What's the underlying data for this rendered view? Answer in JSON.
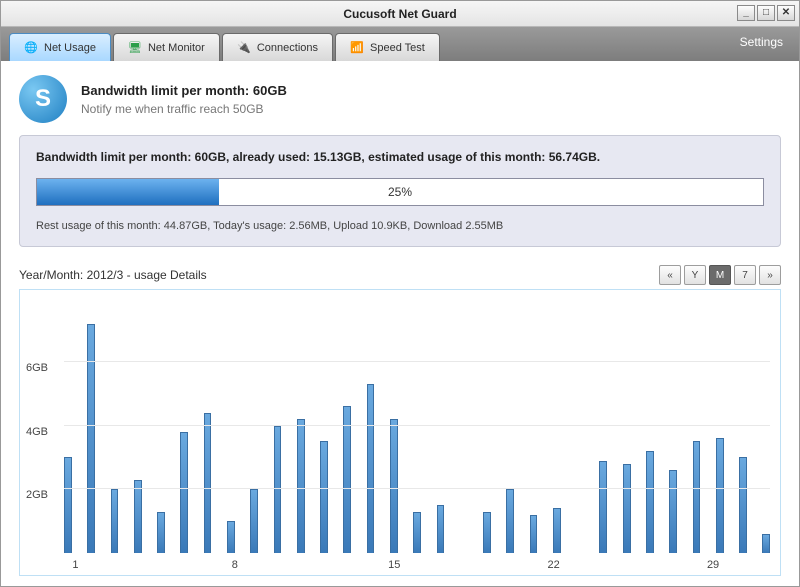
{
  "window": {
    "title": "Cucusoft Net Guard",
    "min": "_",
    "restore": "□",
    "close": "✕"
  },
  "tabs": [
    {
      "label": "Net Usage",
      "icon": "globe",
      "active": true
    },
    {
      "label": "Net Monitor",
      "icon": "monitor",
      "active": false
    },
    {
      "label": "Connections",
      "icon": "plug",
      "active": false
    },
    {
      "label": "Speed Test",
      "icon": "gauge",
      "active": false
    }
  ],
  "settings_label": "Settings",
  "header": {
    "logo_letter": "S",
    "line1": "Bandwidth limit per month: 60GB",
    "line2": "Notify me when traffic reach 50GB"
  },
  "panel": {
    "summary": "Bandwidth limit per month: 60GB, already used: 15.13GB, estimated usage of this month: 56.74GB.",
    "progress_pct": 25,
    "progress_label": "25%",
    "footer": "Rest usage of this month: 44.87GB,    Today's usage: 2.56MB, Upload 10.9KB, Download 2.55MB"
  },
  "details": {
    "label": "Year/Month: 2012/3 - usage Details",
    "range_buttons": [
      "«",
      "Y",
      "M",
      "7",
      "»"
    ],
    "active_range_index": 2
  },
  "chart_data": {
    "type": "bar",
    "title": "",
    "xlabel": "",
    "ylabel": "",
    "ylim": [
      0,
      8
    ],
    "y_ticks": [
      2,
      4,
      6
    ],
    "y_tick_labels": [
      "2GB",
      "4GB",
      "6GB"
    ],
    "x_ticks": [
      1,
      8,
      15,
      22,
      29
    ],
    "x_tick_labels": [
      "1",
      "8",
      "15",
      "22",
      "29"
    ],
    "categories": [
      1,
      2,
      3,
      4,
      5,
      6,
      7,
      8,
      9,
      10,
      11,
      12,
      13,
      14,
      15,
      16,
      17,
      18,
      19,
      20,
      21,
      22,
      23,
      24,
      25,
      26,
      27,
      28,
      29,
      30,
      31
    ],
    "values": [
      3.0,
      7.2,
      2.0,
      2.3,
      1.3,
      3.8,
      4.4,
      1.0,
      2.0,
      4.0,
      4.2,
      3.5,
      4.6,
      5.3,
      4.2,
      1.3,
      1.5,
      0.0,
      1.3,
      2.0,
      1.2,
      1.4,
      0.0,
      2.9,
      2.8,
      3.2,
      2.6,
      3.5,
      3.6,
      3.0,
      0.6
    ]
  }
}
